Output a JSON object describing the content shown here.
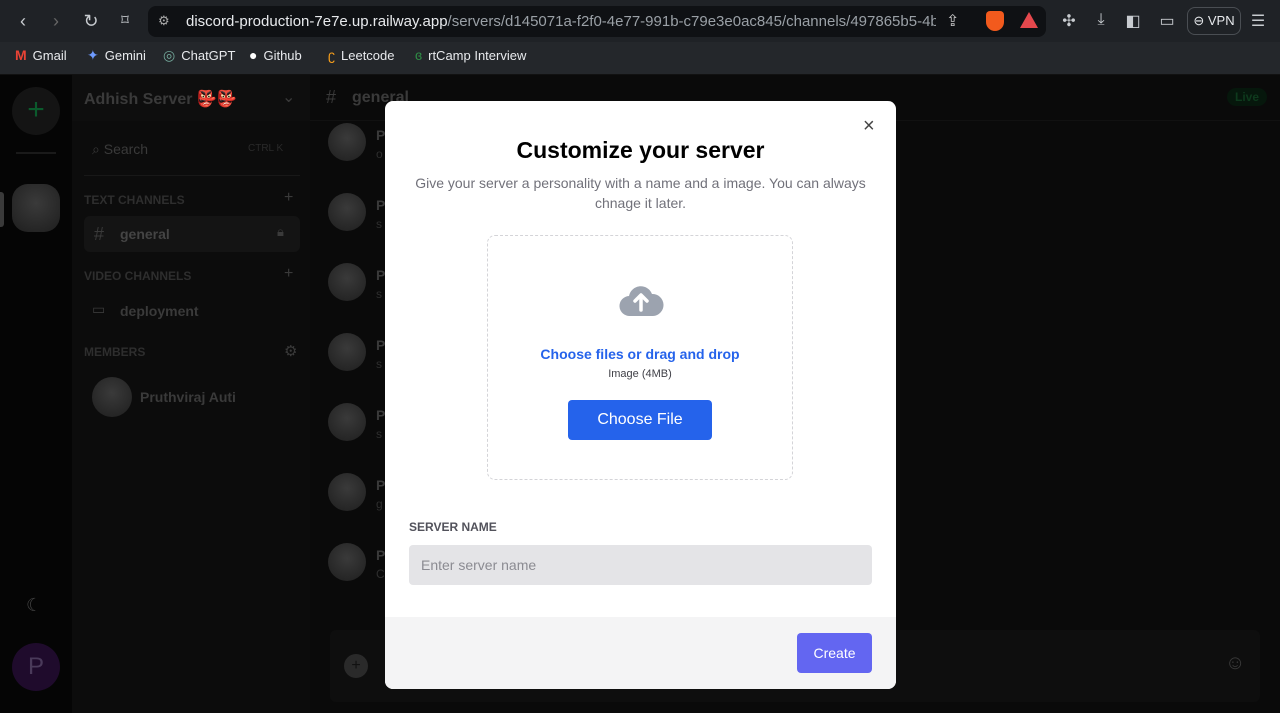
{
  "browser": {
    "url_host": "discord-production-7e7e.up.railway.app",
    "url_path": "/servers/d145071a-f2f0-4e77-991b-c79e3e0ac845/channels/497865b5-4b28-4...",
    "vpn_label": "VPN",
    "bookmarks": [
      {
        "label": "Gmail",
        "icon": "M"
      },
      {
        "label": "Gemini",
        "icon": "✦"
      },
      {
        "label": "ChatGPT",
        "icon": "◎"
      },
      {
        "label": "Github",
        "icon": "●"
      },
      {
        "label": "Leetcode",
        "icon": "ʗ"
      },
      {
        "label": "rtCamp Interview",
        "icon": "ɞ"
      }
    ]
  },
  "sidebar": {
    "server_name": "Adhish Server 👺👺",
    "search_label": "Search",
    "search_shortcut": "CTRL K",
    "text_channels_label": "TEXT CHANNELS",
    "text_channel": "general",
    "video_channels_label": "VIDEO CHANNELS",
    "video_channel": "deployment",
    "members_label": "MEMBERS",
    "member": "Pruthviraj Auti",
    "user_initial": "P"
  },
  "main": {
    "channel_title": "general",
    "live_badge": "Live",
    "messages": [
      {
        "n": "P",
        "t": "o"
      },
      {
        "n": "P",
        "t": "s"
      },
      {
        "n": "P",
        "t": "s"
      },
      {
        "n": "P",
        "t": "s"
      },
      {
        "n": "P",
        "t": "s"
      },
      {
        "n": "P",
        "t": "g"
      },
      {
        "n": "P",
        "t": "C"
      }
    ]
  },
  "modal": {
    "title": "Customize your server",
    "subtitle": "Give your server a personality with a name and a image. You can always chnage it later.",
    "upload_link": "Choose files or drag and drop",
    "upload_hint": "Image (4MB)",
    "choose_file": "Choose File",
    "server_name_label": "SERVER NAME",
    "server_name_placeholder": "Enter server name",
    "server_name_value": "",
    "create": "Create",
    "close": "×"
  },
  "colors": {
    "primary": "#2563eb",
    "create": "#6366f1",
    "live": "#22c55e"
  }
}
